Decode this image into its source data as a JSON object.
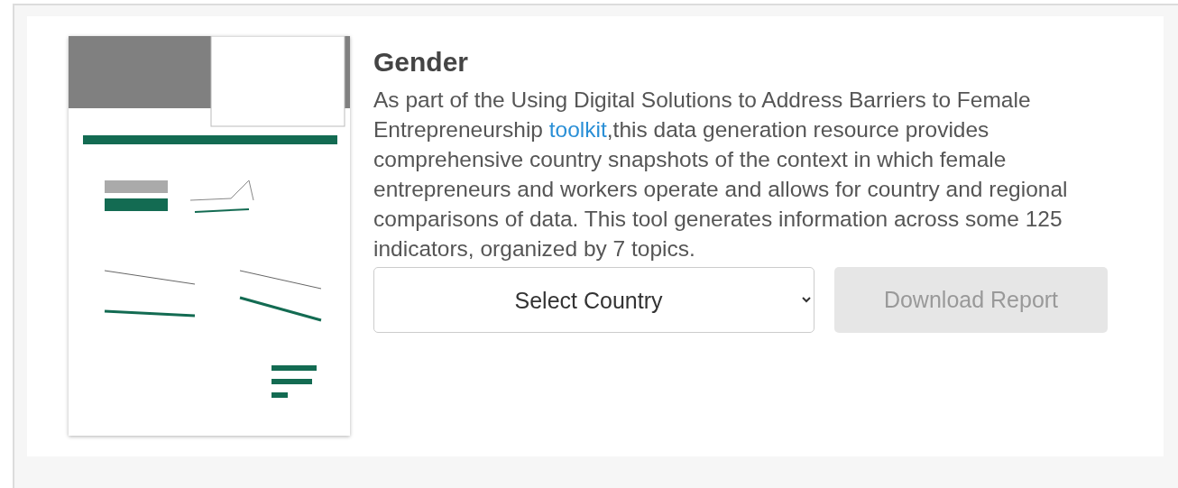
{
  "card": {
    "title": "Gender",
    "description": {
      "before": "As part of the Using Digital Solutions to Address Barriers to Female Entrepreneurship ",
      "link": "toolkit",
      "after": ",this data generation resource provides comprehensive country snapshots of the context in which female entrepreneurs and workers operate and allows for country and regional comparisons of data. This tool generates information across some 125 indicators, organized by 7 topics."
    },
    "country_select": {
      "value": "Select Country"
    },
    "download_button": {
      "label": "Download Report",
      "disabled": true
    }
  }
}
